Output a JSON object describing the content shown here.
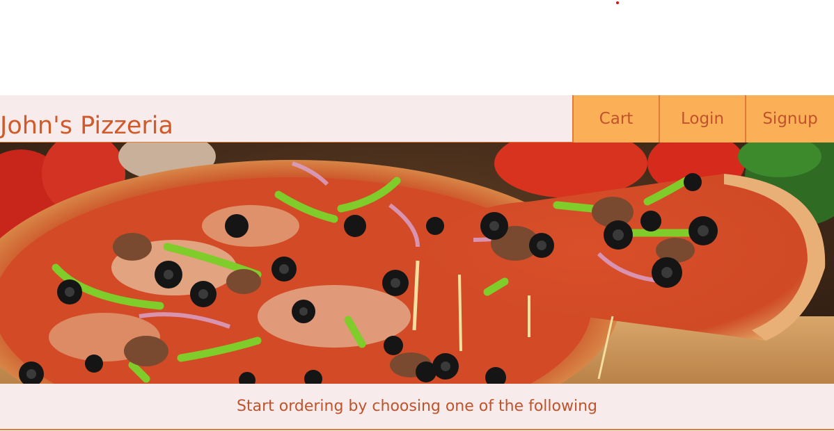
{
  "header": {
    "brand": "John's Pizzeria",
    "nav": [
      {
        "label": "Cart"
      },
      {
        "label": "Login"
      },
      {
        "label": "Signup"
      }
    ]
  },
  "hero": {
    "image": "pizza-photo"
  },
  "subheading": {
    "text": "Start ordering by choosing one of the following"
  },
  "colors": {
    "brand_text": "#d05a2a",
    "nav_bg": "#fbb057",
    "nav_text": "#c0532b",
    "bar_bg": "#f8ebeb",
    "accent_border": "#e07a3a"
  }
}
